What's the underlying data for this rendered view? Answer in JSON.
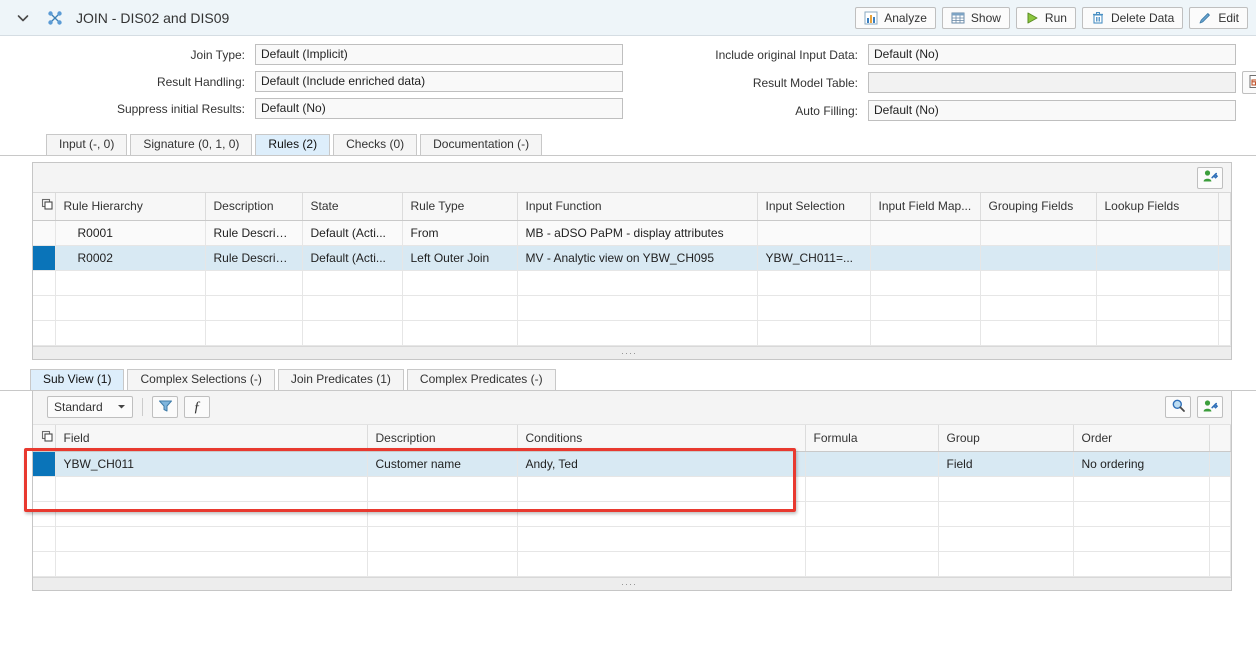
{
  "header": {
    "title": "JOIN - DIS02 and DIS09",
    "collapse_icon": "chevron-down-icon",
    "node_icon": "join-nodes-icon",
    "buttons": [
      {
        "label": "Analyze",
        "icon": "bar-chart-icon"
      },
      {
        "label": "Show",
        "icon": "table-grid-icon"
      },
      {
        "label": "Run",
        "icon": "play-triangle-icon"
      },
      {
        "label": "Delete Data",
        "icon": "trash-icon"
      },
      {
        "label": "Edit",
        "icon": "pencil-icon"
      }
    ]
  },
  "form": {
    "left": [
      {
        "label": "Join Type:",
        "value": "Default (Implicit)"
      },
      {
        "label": "Result Handling:",
        "value": "Default (Include enriched data)"
      },
      {
        "label": "Suppress initial Results:",
        "value": "Default (No)"
      }
    ],
    "right": [
      {
        "label": "Include original Input Data:",
        "value": "Default (No)"
      },
      {
        "label": "Result Model Table:",
        "value": "",
        "button_icon": "model-table-icon"
      },
      {
        "label": "Auto Filling:",
        "value": "Default (No)"
      }
    ]
  },
  "tabs": [
    {
      "label": "Input (-, 0)",
      "active": false
    },
    {
      "label": "Signature (0, 1, 0)",
      "active": false
    },
    {
      "label": "Rules (2)",
      "active": true
    },
    {
      "label": "Checks (0)",
      "active": false
    },
    {
      "label": "Documentation (-)",
      "active": false
    }
  ],
  "rules_table": {
    "settings_icon": "personalize-icon",
    "select_header_icon": "copy-rows-icon",
    "columns": [
      "Rule Hierarchy",
      "Description",
      "State",
      "Rule Type",
      "Input Function",
      "Input Selection",
      "Input Field Map...",
      "Grouping Fields",
      "Lookup Fields"
    ],
    "rows": [
      {
        "selected": false,
        "cells": [
          "R0001",
          "Rule Descripti...",
          "Default (Acti...",
          "From",
          "MB - aDSO PaPM - display attributes",
          "",
          "",
          "",
          ""
        ]
      },
      {
        "selected": true,
        "cells": [
          "R0002",
          "Rule Descripti...",
          "Default (Acti...",
          "Left Outer Join",
          "MV - Analytic view on YBW_CH095",
          "YBW_CH011=...",
          "",
          "",
          ""
        ]
      }
    ],
    "empty_row_count": 3
  },
  "subtabs": [
    {
      "label": "Sub View (1)",
      "active": true
    },
    {
      "label": "Complex Selections (-)",
      "active": false
    },
    {
      "label": "Join Predicates (1)",
      "active": false
    },
    {
      "label": "Complex Predicates (-)",
      "active": false
    }
  ],
  "sub_toolbar": {
    "view_select": "Standard",
    "view_select_caret": "chevron-down-icon",
    "filter_icon": "filter-funnel-icon",
    "formula_icon": "formula-f-icon",
    "search_icon": "magnifier-icon",
    "settings_icon": "personalize-icon"
  },
  "sub_table": {
    "select_header_icon": "copy-rows-icon",
    "columns": [
      "Field",
      "Description",
      "Conditions",
      "Formula",
      "Group",
      "Order"
    ],
    "rows": [
      {
        "selected": true,
        "cells": [
          "YBW_CH011",
          "Customer name",
          "Andy, Ted",
          "",
          "Field",
          "No ordering"
        ]
      }
    ],
    "empty_row_count": 4
  },
  "colors": {
    "accent_blue": "#0a74b9",
    "selected_row": "#d8e9f3",
    "active_tab": "#ddeefb",
    "highlight_red": "#e8392f",
    "titlebar_bg": "#eef5f9"
  }
}
